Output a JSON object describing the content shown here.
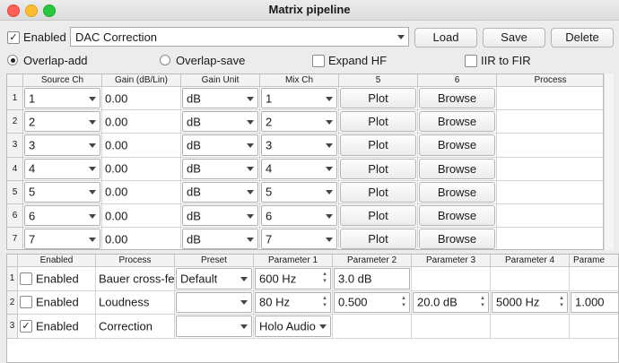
{
  "window": {
    "title": "Matrix pipeline"
  },
  "toolbar": {
    "enabled_label": "Enabled",
    "enabled_checked": true,
    "preset_value": "DAC Correction",
    "load_label": "Load",
    "save_label": "Save",
    "delete_label": "Delete"
  },
  "options": {
    "overlap_add": "Overlap-add",
    "overlap_save": "Overlap-save",
    "expand_hf": "Expand HF",
    "iir_to_fir": "IIR to FIR",
    "selected": "Overlap-add"
  },
  "matrix": {
    "headers": [
      "Source Ch",
      "Gain (dB/Lin)",
      "Gain Unit",
      "Mix Ch",
      "5",
      "6",
      "Process"
    ],
    "rows": [
      {
        "num": "1",
        "source": "1",
        "gain": "0.00",
        "unit": "dB",
        "mix": "1",
        "plot": "Plot",
        "browse": "Browse"
      },
      {
        "num": "2",
        "source": "2",
        "gain": "0.00",
        "unit": "dB",
        "mix": "2",
        "plot": "Plot",
        "browse": "Browse"
      },
      {
        "num": "3",
        "source": "3",
        "gain": "0.00",
        "unit": "dB",
        "mix": "3",
        "plot": "Plot",
        "browse": "Browse"
      },
      {
        "num": "4",
        "source": "4",
        "gain": "0.00",
        "unit": "dB",
        "mix": "4",
        "plot": "Plot",
        "browse": "Browse"
      },
      {
        "num": "5",
        "source": "5",
        "gain": "0.00",
        "unit": "dB",
        "mix": "5",
        "plot": "Plot",
        "browse": "Browse"
      },
      {
        "num": "6",
        "source": "6",
        "gain": "0.00",
        "unit": "dB",
        "mix": "6",
        "plot": "Plot",
        "browse": "Browse"
      },
      {
        "num": "7",
        "source": "7",
        "gain": "0.00",
        "unit": "dB",
        "mix": "7",
        "plot": "Plot",
        "browse": "Browse"
      }
    ]
  },
  "process": {
    "headers": [
      "Enabled",
      "Process",
      "Preset",
      "Parameter 1",
      "Parameter 2",
      "Parameter 3",
      "Parameter 4",
      "Parame"
    ],
    "rows": [
      {
        "num": "1",
        "enabled_label": "Enabled",
        "enabled": false,
        "process": "Bauer cross-feed",
        "preset": "Default",
        "p1": "600 Hz",
        "p2": "3.0 dB",
        "p3": "",
        "p4": "",
        "p5": ""
      },
      {
        "num": "2",
        "enabled_label": "Enabled",
        "enabled": false,
        "process": "Loudness",
        "preset": "",
        "p1": "80 Hz",
        "p2": "0.500",
        "p3": "20.0 dB",
        "p4": "5000 Hz",
        "p5": "1.000"
      },
      {
        "num": "3",
        "enabled_label": "Enabled",
        "enabled": true,
        "process": "Correction",
        "preset": "",
        "p1": "Holo Audio Cyan",
        "p2": "",
        "p3": "",
        "p4": "",
        "p5": ""
      }
    ]
  }
}
